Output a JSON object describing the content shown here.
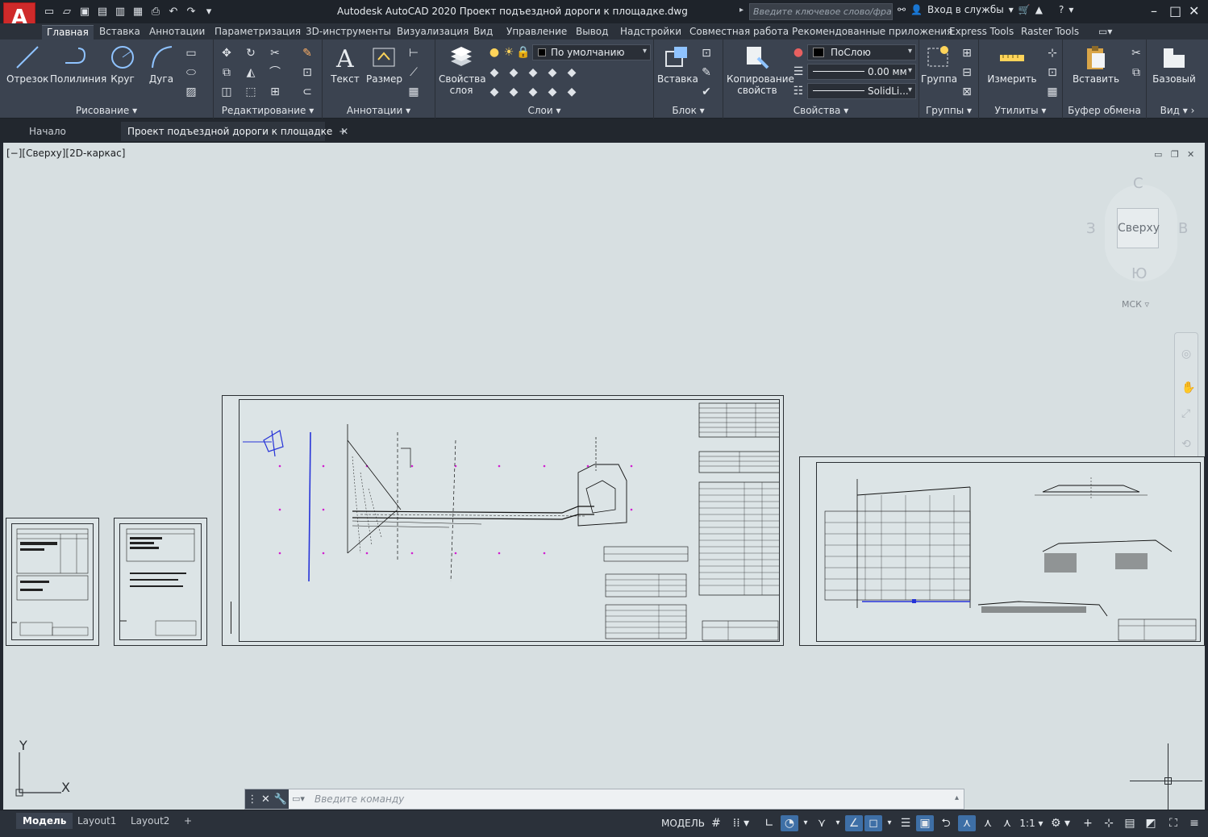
{
  "app": {
    "logo": "A",
    "title": "Autodesk AutoCAD 2020   Проект подъездной дороги к площадке.dwg",
    "search_placeholder": "Введите ключевое слово/фразу",
    "signin": "Вход в службы"
  },
  "ribbon_tabs": [
    "Главная",
    "Вставка",
    "Аннотации",
    "Параметризация",
    "3D-инструменты",
    "Визуализация",
    "Вид",
    "Управление",
    "Вывод",
    "Надстройки",
    "Совместная работа",
    "Рекомендованные приложения",
    "Express Tools",
    "Raster Tools"
  ],
  "ribbon": {
    "draw": {
      "label": "Рисование",
      "line": "Отрезок",
      "polyline": "Полилиния",
      "circle": "Круг",
      "arc": "Дуга"
    },
    "modify": {
      "label": "Редактирование"
    },
    "annotation": {
      "label": "Аннотации",
      "text": "Текст",
      "dimension": "Размер"
    },
    "layers": {
      "label": "Слои",
      "props": "Свойства слоя",
      "current_layer": "По умолчанию"
    },
    "block": {
      "label": "Блок",
      "insert": "Вставка"
    },
    "properties": {
      "label": "Свойства",
      "match": "Копирование свойств",
      "color": "ПоСлою",
      "lineweight": "0.00 мм",
      "linetype": "SolidLi..."
    },
    "groups": {
      "label": "Группы",
      "group": "Группа"
    },
    "utilities": {
      "label": "Утилиты",
      "measure": "Измерить"
    },
    "clipboard": {
      "label": "Буфер обмена",
      "paste": "Вставить"
    },
    "view": {
      "label": "Вид",
      "base": "Базовый"
    }
  },
  "doc_tabs": {
    "start": "Начало",
    "current": "Проект подъездной дороги к площадке"
  },
  "viewport": {
    "label": "[−][Сверху][2D-каркас]",
    "viewcube": {
      "top": "Сверху",
      "n": "С",
      "s": "Ю",
      "w": "З",
      "e": "В",
      "ucs": "МСК"
    },
    "ucs_x": "X",
    "ucs_y": "Y"
  },
  "command": {
    "placeholder": "Введите команду"
  },
  "layout_tabs": [
    "Модель",
    "Layout1",
    "Layout2"
  ],
  "status": {
    "model": "МОДЕЛЬ",
    "scale": "1:1"
  }
}
